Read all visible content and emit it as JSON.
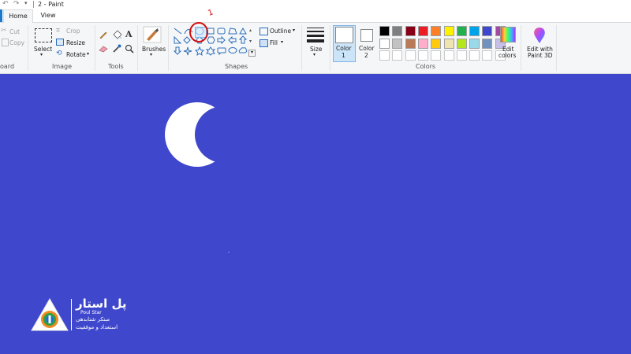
{
  "titlebar": {
    "title": "2 - Paint"
  },
  "tabs": [
    {
      "label": "Home"
    },
    {
      "label": "View"
    }
  ],
  "clipboard": {
    "cut": "Cut",
    "copy": "Copy",
    "group": "oard"
  },
  "image": {
    "select": "Select",
    "crop": "Crop",
    "resize": "Resize",
    "rotate": "Rotate",
    "group": "Image"
  },
  "tools": {
    "group": "Tools"
  },
  "brushes": {
    "label": "Brushes"
  },
  "shapes": {
    "group": "Shapes",
    "outline": "Outline",
    "fill": "Fill",
    "annotation": "1"
  },
  "size": {
    "label": "Size"
  },
  "colors": {
    "color1": "Color",
    "color1_num": "1",
    "color2": "Color",
    "color2_num": "2",
    "edit": "Edit",
    "edit2": "colors",
    "group": "Colors",
    "palette_row1": [
      "#000000",
      "#7f7f7f",
      "#880015",
      "#ed1c24",
      "#ff7f27",
      "#fff200",
      "#22b14c",
      "#00a2e8",
      "#3f48cc",
      "#a349a4"
    ],
    "palette_row2": [
      "#ffffff",
      "#c3c3c3",
      "#b97a57",
      "#ffaec9",
      "#ffc90e",
      "#efe4b0",
      "#b5e61d",
      "#99d9ea",
      "#7092be",
      "#c8bfe7"
    ]
  },
  "paint3d": {
    "label1": "Edit with",
    "label2": "Paint 3D"
  },
  "canvas": {
    "background": "#3f48cc"
  },
  "watermark": {
    "brand": "پل استار",
    "brand_en": "Poul Star",
    "line1": "مبتکر شتابدهی",
    "line2": "استعداد و موفقیت"
  }
}
